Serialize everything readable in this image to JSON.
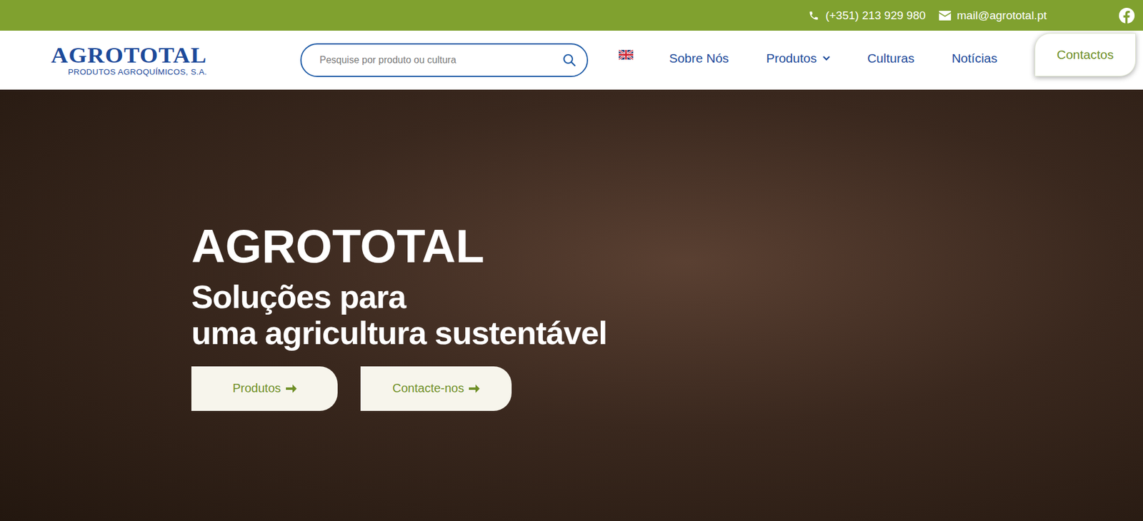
{
  "topbar": {
    "phone": "(+351) 213 929 980",
    "email": "mail@agrototal.pt"
  },
  "logo": {
    "name": "AGROTOTAL",
    "subtitle": "PRODUTOS AGROQUÍMICOS, S.A."
  },
  "search": {
    "placeholder": "Pesquise por produto ou cultura"
  },
  "nav": [
    {
      "label": "Sobre Nós",
      "has_dropdown": false
    },
    {
      "label": "Produtos",
      "has_dropdown": true
    },
    {
      "label": "Culturas",
      "has_dropdown": false
    },
    {
      "label": "Notícias",
      "has_dropdown": false
    }
  ],
  "cta": "Contactos",
  "hero": {
    "title": "AGROTOTAL",
    "subtitle_lines": [
      "Soluções para",
      "uma agricultura sustentável"
    ],
    "buttons": [
      "Produtos",
      "Contacte-nos"
    ]
  }
}
